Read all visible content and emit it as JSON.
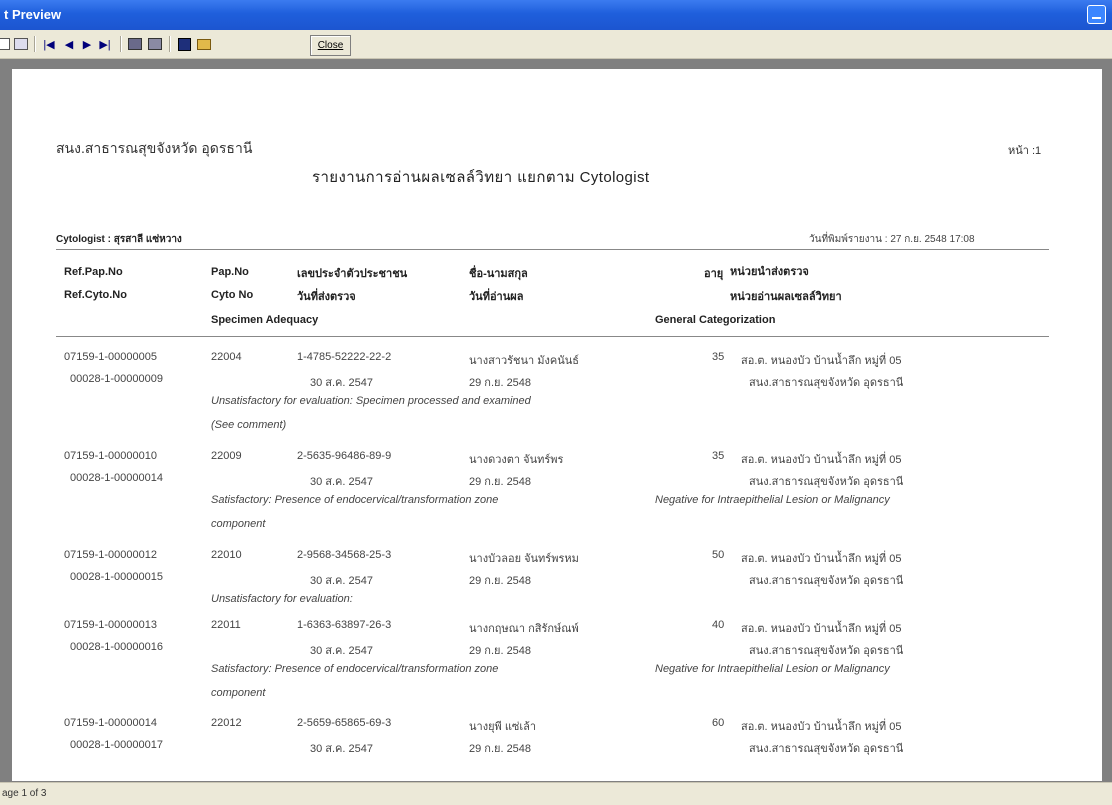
{
  "window": {
    "title": "t Preview"
  },
  "toolbar": {
    "close_label": "Close"
  },
  "status": "age 1 of 3",
  "report": {
    "org": "สนง.สาธารณสุขจังหวัด อุดรธานี",
    "page_label": "หน้า :1",
    "title": "รายงานการอ่านผลเซลล์วิทยา แยกตาม Cytologist",
    "cytologist": "Cytologist : สุรสาลี แซ่หวาง",
    "printed": "วันที่พิมพ์รายงาน : 27 ก.ย. 2548 17:08",
    "headers": {
      "ref_pap": "Ref.Pap.No",
      "ref_cyto": "Ref.Cyto.No",
      "pap": "Pap.No",
      "cyto": "Cyto No",
      "id": "เลขประจำตัวประชาชน",
      "reg_date": "วันที่ส่งตรวจ",
      "name": "ชื่อ-นามสกุล",
      "read_date": "วันที่อ่านผล",
      "age": "อายุ",
      "unit_send": "หน่วยนำส่งตรวจ",
      "unit_read": "หน่วยอ่านผลเซลล์วิทยา",
      "adequacy": "Specimen Adequacy",
      "categorization": "General Categorization"
    },
    "records": [
      {
        "ref_pap": "07159-1-00000005",
        "ref_cyto": "00028-1-00000009",
        "pap": "22004",
        "id": "1-4785-52222-22-2",
        "reg_date": "30 ส.ค. 2547",
        "name": "นางสาวรัชนา มังคนันธ์",
        "read_date": "29 ก.ย. 2548",
        "age": "35",
        "unit1": "สอ.ต. หนองบัว บ้านน้ำลึก หมู่ที่ 05",
        "unit2": "สนง.สาธารณสุขจังหวัด อุดรธานี",
        "adequacy_1": "Unsatisfactory for evaluation: Specimen processed and examined",
        "adequacy_2": "(See comment)",
        "category": ""
      },
      {
        "ref_pap": "07159-1-00000010",
        "ref_cyto": "00028-1-00000014",
        "pap": "22009",
        "id": "2-5635-96486-89-9",
        "reg_date": "30 ส.ค. 2547",
        "name": "นางดวงตา จันทร์พร",
        "read_date": "29 ก.ย. 2548",
        "age": "35",
        "unit1": "สอ.ต. หนองบัว บ้านน้ำลึก หมู่ที่ 05",
        "unit2": "สนง.สาธารณสุขจังหวัด อุดรธานี",
        "adequacy_1": "Satisfactory: Presence of endocervical/transformation zone",
        "adequacy_2": "component",
        "category": "Negative for Intraepithelial Lesion or Malignancy"
      },
      {
        "ref_pap": "07159-1-00000012",
        "ref_cyto": "00028-1-00000015",
        "pap": "22010",
        "id": "2-9568-34568-25-3",
        "reg_date": "30 ส.ค. 2547",
        "name": "นางบัวลอย จันทร์พรหม",
        "read_date": "29 ก.ย. 2548",
        "age": "50",
        "unit1": "สอ.ต. หนองบัว บ้านน้ำลึก หมู่ที่ 05",
        "unit2": "สนง.สาธารณสุขจังหวัด อุดรธานี",
        "adequacy_1": "Unsatisfactory for evaluation:",
        "adequacy_2": "",
        "category": ""
      },
      {
        "ref_pap": "07159-1-00000013",
        "ref_cyto": "00028-1-00000016",
        "pap": "22011",
        "id": "1-6363-63897-26-3",
        "reg_date": "30 ส.ค. 2547",
        "name": "นางกฤษณา กสิรักษ์ณพ์",
        "read_date": "29 ก.ย. 2548",
        "age": "40",
        "unit1": "สอ.ต. หนองบัว บ้านน้ำลึก หมู่ที่ 05",
        "unit2": "สนง.สาธารณสุขจังหวัด อุดรธานี",
        "adequacy_1": "Satisfactory: Presence of endocervical/transformation zone",
        "adequacy_2": "component",
        "category": "Negative for Intraepithelial Lesion or Malignancy"
      },
      {
        "ref_pap": "07159-1-00000014",
        "ref_cyto": "00028-1-00000017",
        "pap": "22012",
        "id": "2-5659-65865-69-3",
        "reg_date": "30 ส.ค. 2547",
        "name": "นางยุพี แซ่เล้า",
        "read_date": "29 ก.ย. 2548",
        "age": "60",
        "unit1": "สอ.ต. หนองบัว บ้านน้ำลึก หมู่ที่ 05",
        "unit2": "สนง.สาธารณสุขจังหวัด อุดรธานี",
        "adequacy_1": "",
        "adequacy_2": "",
        "category": ""
      }
    ]
  }
}
